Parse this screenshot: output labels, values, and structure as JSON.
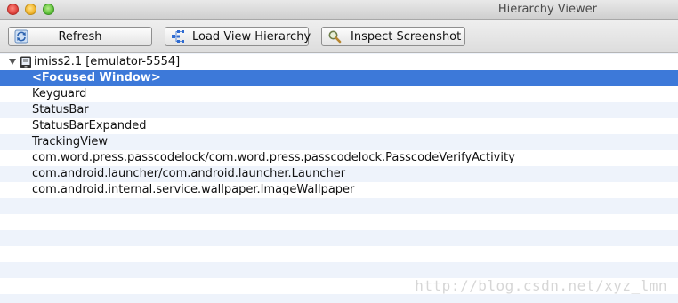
{
  "window": {
    "title": "Hierarchy Viewer"
  },
  "toolbar": {
    "refresh_label": "Refresh",
    "load_label": "Load View Hierarchy",
    "inspect_label": "Inspect Screenshot",
    "refresh_icon": "refresh-icon",
    "load_icon": "hierarchy-icon",
    "inspect_icon": "magnifier-icon"
  },
  "tree": {
    "device": {
      "label": "imiss2.1 [emulator-5554]",
      "icon": "device-icon",
      "expanded": true
    },
    "windows": [
      {
        "label": "<Focused Window>",
        "selected": true
      },
      {
        "label": "Keyguard"
      },
      {
        "label": "StatusBar"
      },
      {
        "label": "StatusBarExpanded"
      },
      {
        "label": "TrackingView"
      },
      {
        "label": "com.word.press.passcodelock/com.word.press.passcodelock.PasscodeVerifyActivity"
      },
      {
        "label": "com.android.launcher/com.android.launcher.Launcher"
      },
      {
        "label": "com.android.internal.service.wallpaper.ImageWallpaper"
      }
    ]
  },
  "watermark": "http://blog.csdn.net/xyz_lmn",
  "colors": {
    "selection": "#3d79d9",
    "stripe": "#eef3fb"
  }
}
